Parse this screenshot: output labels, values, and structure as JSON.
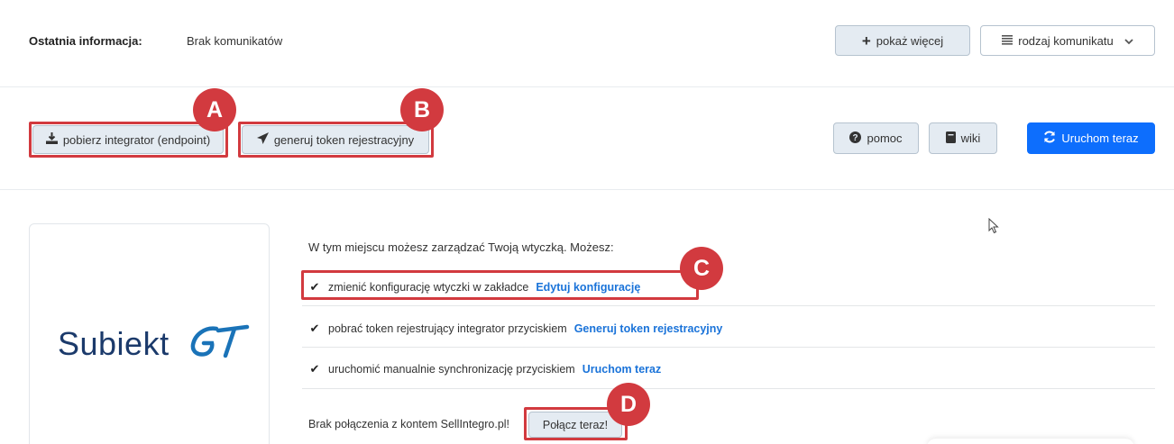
{
  "top": {
    "info_label": "Ostatnia informacja:",
    "info_value": "Brak komunikatów",
    "show_more_label": "pokaż więcej",
    "message_type_label": "rodzaj komunikatu"
  },
  "toolbar": {
    "download_label": "pobierz integrator (endpoint)",
    "token_label": "generuj token rejestracyjny",
    "help_label": "pomoc",
    "wiki_label": "wiki",
    "run_label": "Uruchom teraz"
  },
  "logo": {
    "text": "Subiekt",
    "suffix": "GT"
  },
  "content": {
    "intro": "W tym miejscu możesz zarządzać Twoją wtyczką. Możesz:",
    "items": [
      {
        "text": "zmienić konfigurację wtyczki w zakładce",
        "link": "Edytuj konfigurację"
      },
      {
        "text": "pobrać token rejestrujący integrator przyciskiem",
        "link": "Generuj token rejestracyjny"
      },
      {
        "text": "uruchomić manualnie synchronizację przyciskiem",
        "link": "Uruchom teraz"
      }
    ],
    "connection_text": "Brak połączenia z kontem SellIntegro.pl!",
    "connect_label": "Połącz teraz!"
  },
  "annotations": {
    "a": "A",
    "b": "B",
    "c": "C",
    "d": "D"
  },
  "colors": {
    "accent": "#0d6efd",
    "link": "#1a73d9",
    "highlight": "#d23a3f",
    "button_light": "#e4ebf2"
  },
  "icons": {
    "show_more": "plus-icon",
    "message_type": "list-icon",
    "dropdown": "chevron-down-icon",
    "download": "download-icon",
    "token": "paper-plane-icon",
    "help": "question-circle-icon",
    "wiki": "book-icon",
    "run": "refresh-icon",
    "check": "check-icon",
    "cursor": "mouse-cursor-icon"
  }
}
